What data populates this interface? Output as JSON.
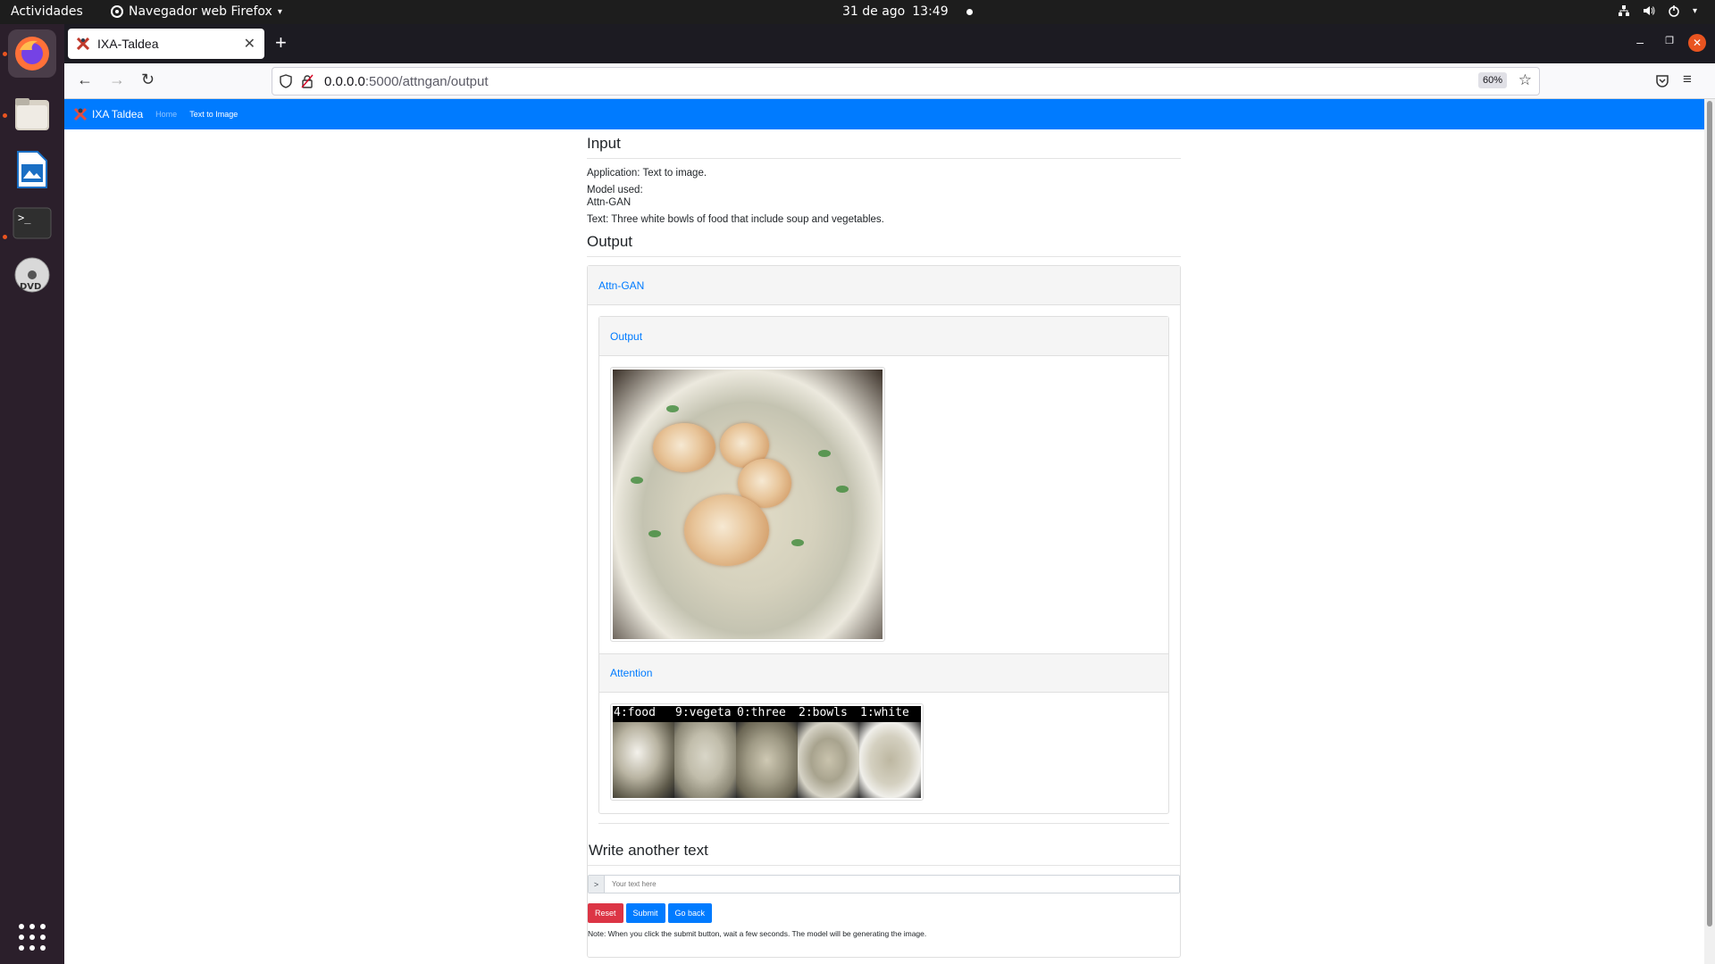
{
  "system_bar": {
    "activities": "Actividades",
    "app_menu": "Navegador web Firefox",
    "date": "31 de ago",
    "time": "13:49"
  },
  "browser": {
    "tab_title": "IXA-Taldea",
    "url_host": "0.0.0.0",
    "url_path": ":5000/attngan/output",
    "zoom": "60%"
  },
  "site_nav": {
    "brand": "IXA Taldea",
    "links": [
      "Home",
      "Text to Image"
    ]
  },
  "input_section": {
    "heading": "Input",
    "application": "Application: Text to image.",
    "model_label": "Model used:",
    "model": "Attn-GAN",
    "text": "Text: Three white bowls of food that include soup and vegetables."
  },
  "output_section": {
    "heading": "Output",
    "card_title": "Attn-GAN",
    "output_title": "Output",
    "attention_title": "Attention",
    "attention_words": [
      "4:food",
      "9:vegeta",
      "0:three",
      "2:bowls",
      "1:white"
    ]
  },
  "form": {
    "heading": "Write another text",
    "prompt_symbol": ">",
    "placeholder": "Your text here",
    "reset": "Reset",
    "submit": "Submit",
    "go_back": "Go back",
    "note": "Note: When you click the submit button, wait a few seconds. The model will be generating the image."
  }
}
